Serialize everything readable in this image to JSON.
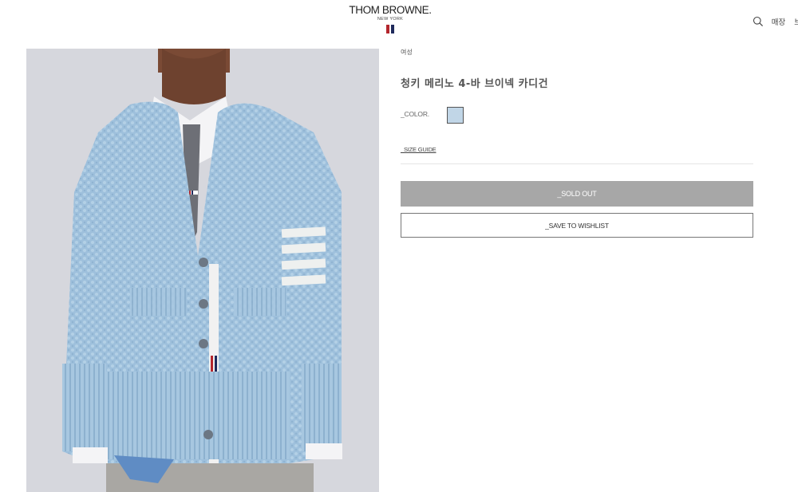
{
  "header": {
    "logo": {
      "brand": "THOM BROWNE.",
      "city": "NEW YORK"
    },
    "nav": {
      "search_icon": "search-icon",
      "stores_label": "매장",
      "cut_label": "브"
    }
  },
  "product": {
    "image_alt": "청키 메리노 4-바 브이넥 카디건",
    "category": "여성",
    "title": "청키 메리노 4-바 브이넥 카디건",
    "color_label": "_COLOR.",
    "selected_color": "#c1d6e7",
    "size_guide_label": "_SIZE GUIDE",
    "sold_out_label": "_SOLD OUT",
    "wishlist_label": "_SAVE TO WISHLIST"
  },
  "colors": {
    "brand_red": "#b3262d",
    "brand_navy": "#1f2a5c",
    "sold_out_bg": "#a7a7a7"
  }
}
